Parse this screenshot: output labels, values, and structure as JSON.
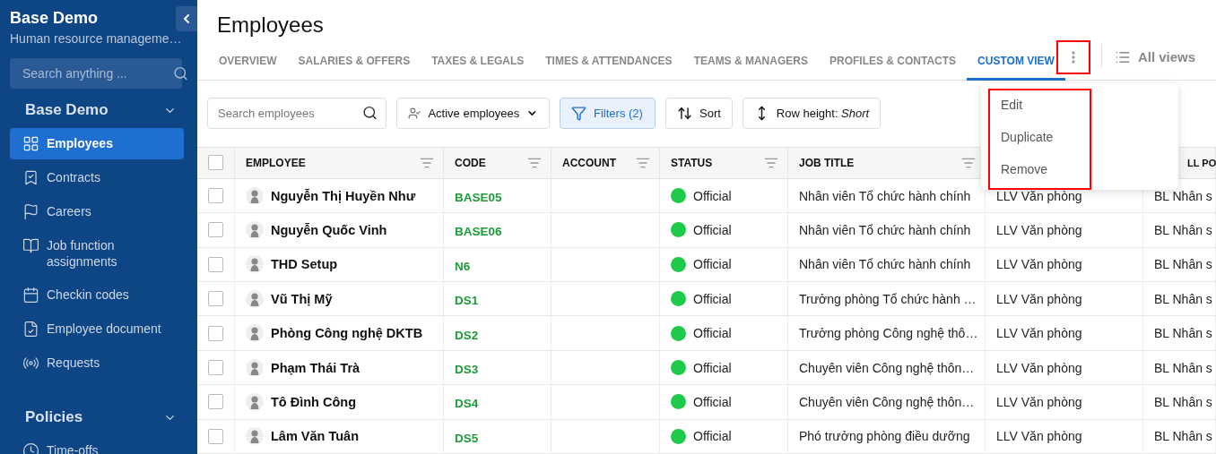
{
  "sidebar": {
    "title": "Base Demo",
    "subtitle": "Human resource manageme…",
    "search": {
      "placeholder": "Search anything ..."
    },
    "groups": [
      {
        "label": "Base Demo",
        "expanded": true,
        "items": [
          {
            "label": "Employees",
            "selected": true
          },
          {
            "label": "Contracts",
            "selected": false
          },
          {
            "label": "Careers",
            "selected": false
          },
          {
            "label": "Job function assignments",
            "selected": false
          },
          {
            "label": "Checkin codes",
            "selected": false
          },
          {
            "label": "Employee document",
            "selected": false
          },
          {
            "label": "Requests",
            "selected": false
          }
        ]
      },
      {
        "label": "Policies",
        "expanded": true,
        "items": [
          {
            "label": "Time-offs",
            "selected": false
          }
        ]
      }
    ]
  },
  "page": {
    "title": "Employees"
  },
  "tabs": [
    {
      "label": "OVERVIEW",
      "selected": false
    },
    {
      "label": "SALARIES & OFFERS",
      "selected": false
    },
    {
      "label": "TAXES & LEGALS",
      "selected": false
    },
    {
      "label": "TIMES & ATTENDANCES",
      "selected": false
    },
    {
      "label": "TEAMS & MANAGERS",
      "selected": false
    },
    {
      "label": "PROFILES & CONTACTS",
      "selected": false
    },
    {
      "label": "CUSTOM VIEW",
      "selected": true,
      "menu_button": {
        "highlighted": true
      }
    }
  ],
  "all_views": "All views",
  "toolbar": {
    "search": {
      "placeholder": "Search employees"
    },
    "active": "Active employees",
    "filters": "Filters (2)",
    "sort": "Sort",
    "row_height_label": "Row height: ",
    "row_height_value": "Short"
  },
  "view_menu": {
    "highlighted": true,
    "items": [
      "Edit",
      "Duplicate",
      "Remove"
    ]
  },
  "table": {
    "all_checked": false,
    "columns": [
      {
        "label": "EMPLOYEE",
        "filter": true
      },
      {
        "label": "CODE",
        "filter": true
      },
      {
        "label": "ACCOUNT",
        "filter": true
      },
      {
        "label": "STATUS",
        "filter": true
      },
      {
        "label": "JOB TITLE",
        "filter": true
      },
      {
        "label": "LL PO",
        "filter": false
      }
    ],
    "rows": [
      {
        "checked": false,
        "employee": "Nguyễn Thị Huyền Như",
        "code": "BASE05",
        "status": "Official",
        "color": "#1fc94a",
        "job_title": "Nhân viên Tổ chức hành chính",
        "column_6": "LLV Văn phòng",
        "column_7": "BL Nhân s"
      },
      {
        "checked": false,
        "employee": "Nguyễn Quốc Vinh",
        "code": "BASE06",
        "status": "Official",
        "color": "#1fc94a",
        "job_title": "Nhân viên Tổ chức hành chính",
        "column_6": "LLV Văn phòng",
        "column_7": "BL Nhân s"
      },
      {
        "checked": false,
        "employee": "THD Setup",
        "code": "N6",
        "status": "Official",
        "color": "#1fc94a",
        "job_title": "Nhân viên Tổ chức hành chính",
        "column_6": "LLV Văn phòng",
        "column_7": "BL Nhân s"
      },
      {
        "checked": false,
        "employee": "Vũ Thị Mỹ",
        "code": "DS1",
        "status": "Official",
        "color": "#1fc94a",
        "job_title": "Trưởng phòng Tổ chức hành …",
        "column_6": "LLV Văn phòng",
        "column_7": "BL Nhân s"
      },
      {
        "checked": false,
        "employee": "Phòng Công nghệ DKTB",
        "code": "DS2",
        "status": "Official",
        "color": "#1fc94a",
        "job_title": "Trưởng phòng Công nghệ thô…",
        "column_6": "LLV Văn phòng",
        "column_7": "BL Nhân s"
      },
      {
        "checked": false,
        "employee": "Phạm Thái Trà",
        "code": "DS3",
        "status": "Official",
        "color": "#1fc94a",
        "job_title": "Chuyên viên Công nghệ thôn…",
        "column_6": "LLV Văn phòng",
        "column_7": "BL Nhân s"
      },
      {
        "checked": false,
        "employee": "Tô Đình Công",
        "code": "DS4",
        "status": "Official",
        "color": "#1fc94a",
        "job_title": "Chuyên viên Công nghệ thôn…",
        "column_6": "LLV Văn phòng",
        "column_7": "BL Nhân s"
      },
      {
        "checked": false,
        "employee": "Lâm Văn Tuân",
        "code": "DS5",
        "status": "Official",
        "color": "#1fc94a",
        "job_title": "Phó trưởng phòng điều dưỡng",
        "column_6": "LLV Văn phòng",
        "column_7": "BL Nhân s"
      }
    ]
  }
}
